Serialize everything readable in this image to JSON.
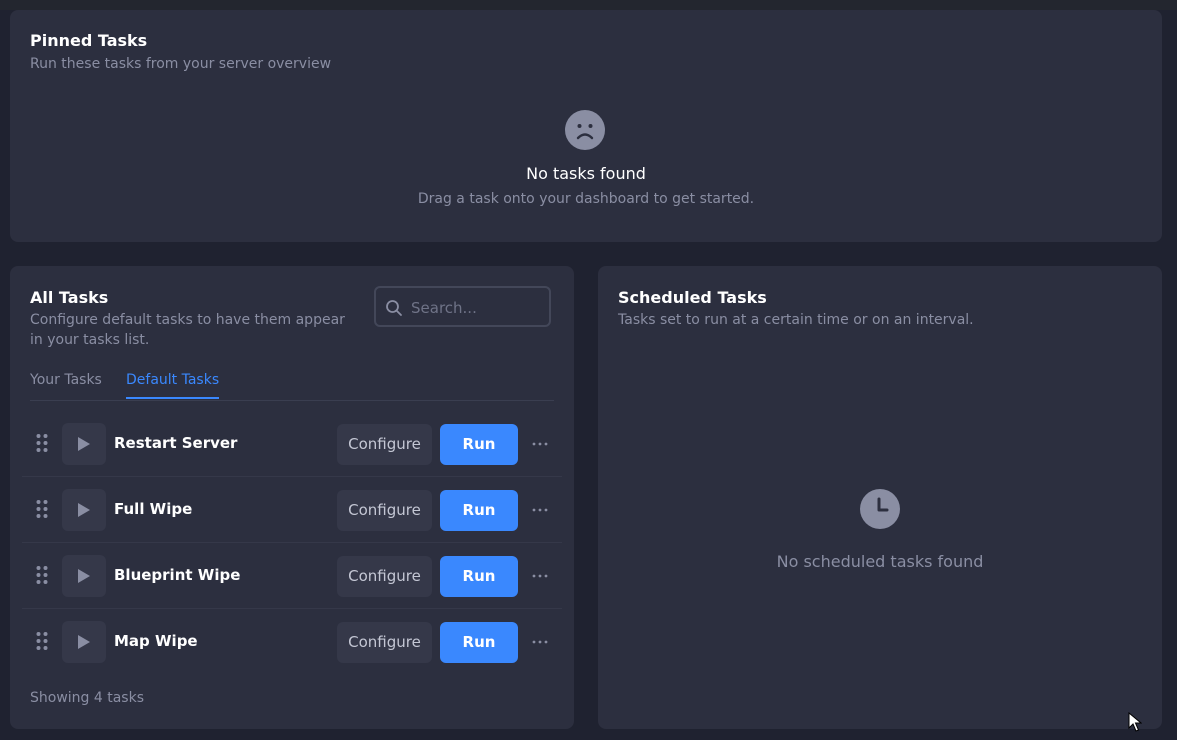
{
  "pinned": {
    "title": "Pinned Tasks",
    "subtitle": "Run these tasks from your server overview",
    "empty_icon": "sad-face-icon",
    "empty_title": "No tasks found",
    "empty_subtitle": "Drag a task onto your dashboard to get started."
  },
  "all_tasks": {
    "title": "All Tasks",
    "subtitle": "Configure default tasks to have them appear in your tasks list.",
    "search": {
      "placeholder": "Search...",
      "value": "",
      "icon": "search-icon"
    },
    "tabs": [
      {
        "label": "Your Tasks",
        "active": false
      },
      {
        "label": "Default Tasks",
        "active": true
      }
    ],
    "configure_label": "Configure",
    "run_label": "Run",
    "tasks": [
      {
        "name": "Restart Server"
      },
      {
        "name": "Full Wipe"
      },
      {
        "name": "Blueprint Wipe"
      },
      {
        "name": "Map Wipe"
      }
    ],
    "footer": "Showing 4 tasks"
  },
  "scheduled": {
    "title": "Scheduled Tasks",
    "subtitle": "Tasks set to run at a certain time or on an interval.",
    "empty_icon": "clock-icon",
    "empty_title": "No scheduled tasks found"
  },
  "colors": {
    "background": "#1f2230",
    "card": "#2c2f3f",
    "accent": "#3a88fe",
    "muted_text": "#8a8ea3"
  }
}
